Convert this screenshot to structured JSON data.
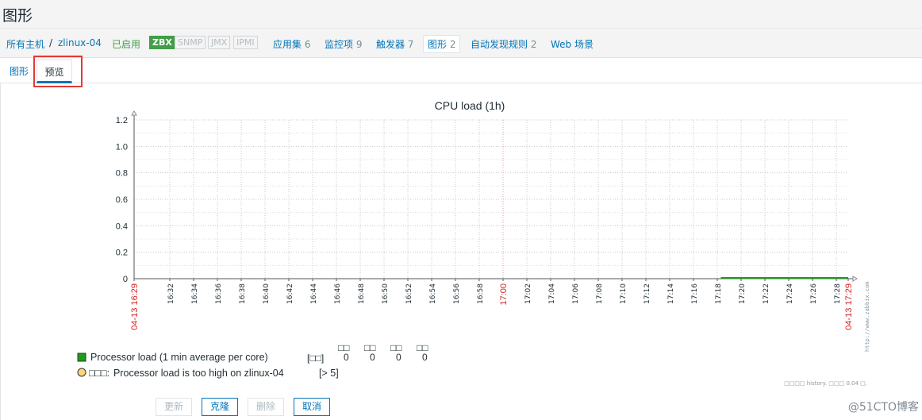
{
  "page": {
    "title": "图形"
  },
  "host_nav": {
    "all_hosts": "所有主机",
    "separator": "/",
    "host": "zlinux-04",
    "status": "已启用",
    "availability": [
      "ZBX",
      "SNMP",
      "JMX",
      "IPMI"
    ],
    "items": [
      {
        "label": "应用集",
        "count": "6"
      },
      {
        "label": "监控项",
        "count": "9"
      },
      {
        "label": "触发器",
        "count": "7"
      },
      {
        "label": "图形",
        "count": "2"
      },
      {
        "label": "自动发现规则",
        "count": "2"
      },
      {
        "label": "Web 场景",
        "count": ""
      }
    ]
  },
  "tabs": {
    "graph": "图形",
    "preview": "预览"
  },
  "chart_data": {
    "type": "line",
    "title": "CPU load (1h)",
    "ylim": [
      0,
      1.2
    ],
    "y_ticks": [
      "0",
      "0.2",
      "0.4",
      "0.6",
      "0.8",
      "1.0",
      "1.2"
    ],
    "x_ticks": [
      "04-13 16:29",
      "16:32",
      "16:34",
      "16:36",
      "16:38",
      "16:40",
      "16:42",
      "16:44",
      "16:46",
      "16:48",
      "16:50",
      "16:52",
      "16:54",
      "16:56",
      "16:58",
      "17:00",
      "17:02",
      "17:04",
      "17:06",
      "17:08",
      "17:10",
      "17:12",
      "17:14",
      "17:16",
      "17:18",
      "17:20",
      "17:22",
      "17:24",
      "17:26",
      "17:28",
      "04-13 17:29"
    ],
    "x_minutes": [
      0,
      3,
      5,
      7,
      9,
      11,
      13,
      15,
      17,
      19,
      21,
      23,
      25,
      27,
      29,
      31,
      33,
      35,
      37,
      39,
      41,
      43,
      45,
      47,
      49,
      51,
      53,
      55,
      57,
      59,
      60
    ],
    "highlight_ticks": [
      "04-13 16:29",
      "17:00",
      "04-13 17:29"
    ],
    "grid": true,
    "series": [
      {
        "name": "Processor load (1 min average per core)",
        "color": "#1a9e1a",
        "x_minutes": [
          49.3,
          60
        ],
        "values": [
          0,
          0
        ]
      }
    ],
    "legend": {
      "column_headers": [
        "□□",
        "□□",
        "□□",
        "□□"
      ],
      "rows": [
        {
          "name": "Processor load (1 min average per core)",
          "func": "[□□]",
          "values": [
            "0",
            "0",
            "0",
            "0"
          ],
          "color": "#1a9e1a"
        }
      ],
      "trigger": {
        "prefix": "□□□:",
        "name": "Processor load is too high on zlinux-04",
        "threshold": "[> 5]",
        "color": "#ffd37a"
      }
    },
    "side_url": "http://www.zabbix.com",
    "footer_note": "□□□□ history. □□□ 0.04 □."
  },
  "buttons": {
    "update": "更新",
    "clone": "克隆",
    "delete": "删除",
    "cancel": "取消"
  },
  "watermark": "@51CTO博客"
}
